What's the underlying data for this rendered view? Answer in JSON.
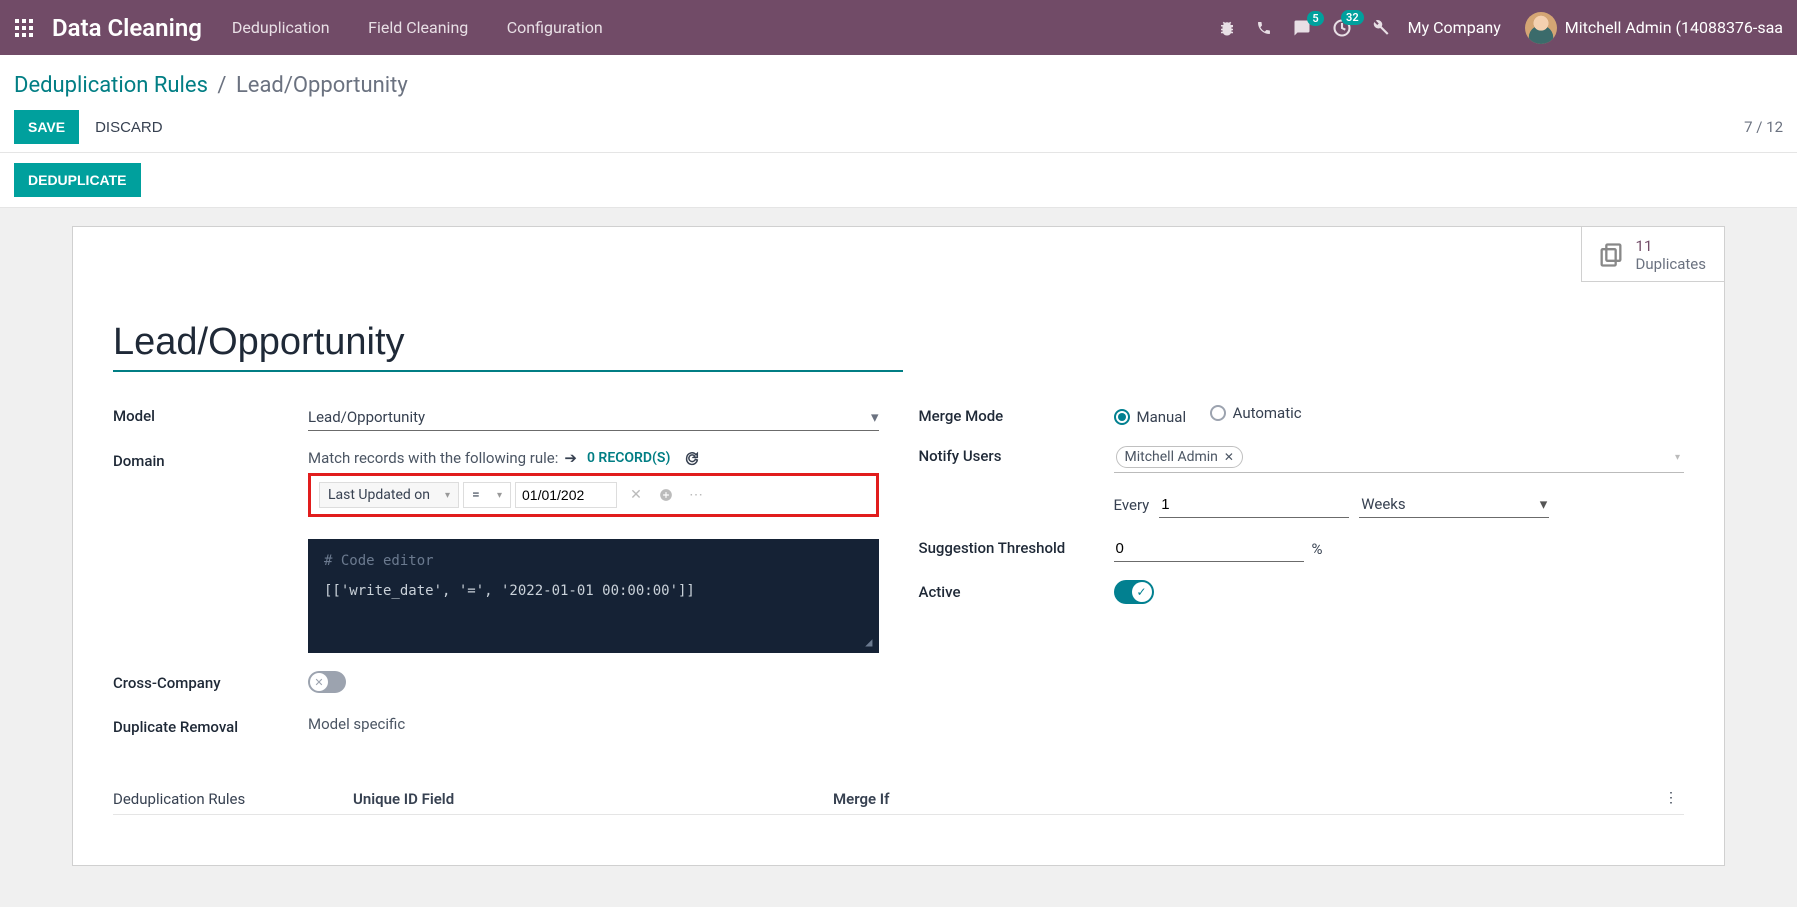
{
  "topbar": {
    "brand": "Data Cleaning",
    "nav": [
      "Deduplication",
      "Field Cleaning",
      "Configuration"
    ],
    "chat_badge": "5",
    "activity_badge": "32",
    "company": "My Company",
    "user": "Mitchell Admin (14088376-saa"
  },
  "breadcrumb": {
    "link": "Deduplication Rules",
    "current": "Lead/Opportunity",
    "save": "SAVE",
    "discard": "DISCARD",
    "pager": "7 / 12"
  },
  "status": {
    "dedup": "DEDUPLICATE"
  },
  "stat": {
    "count": "11",
    "label": "Duplicates"
  },
  "form": {
    "title": "Lead/Opportunity",
    "labels": {
      "model": "Model",
      "domain": "Domain",
      "cross": "Cross-Company",
      "dupremoval": "Duplicate Removal",
      "mergemode": "Merge Mode",
      "notify": "Notify Users",
      "suggestion": "Suggestion Threshold",
      "active": "Active"
    },
    "model_value": "Lead/Opportunity",
    "domain_match": "Match records with the following rule:",
    "records": "0 RECORD(S)",
    "rule": {
      "field": "Last Updated on",
      "op": "=",
      "value": "01/01/202"
    },
    "code_comment": "# Code editor",
    "code_line": "[['write_date', '=', '2022-01-01 00:00:00']]",
    "dupremoval_value": "Model specific",
    "merge_manual": "Manual",
    "merge_auto": "Automatic",
    "notify_tag": "Mitchell Admin",
    "every": "Every",
    "every_val": "1",
    "every_unit": "Weeks",
    "threshold_val": "0",
    "pct": "%"
  },
  "table": {
    "section": "Deduplication Rules",
    "col1": "Unique ID Field",
    "col2": "Merge If"
  }
}
